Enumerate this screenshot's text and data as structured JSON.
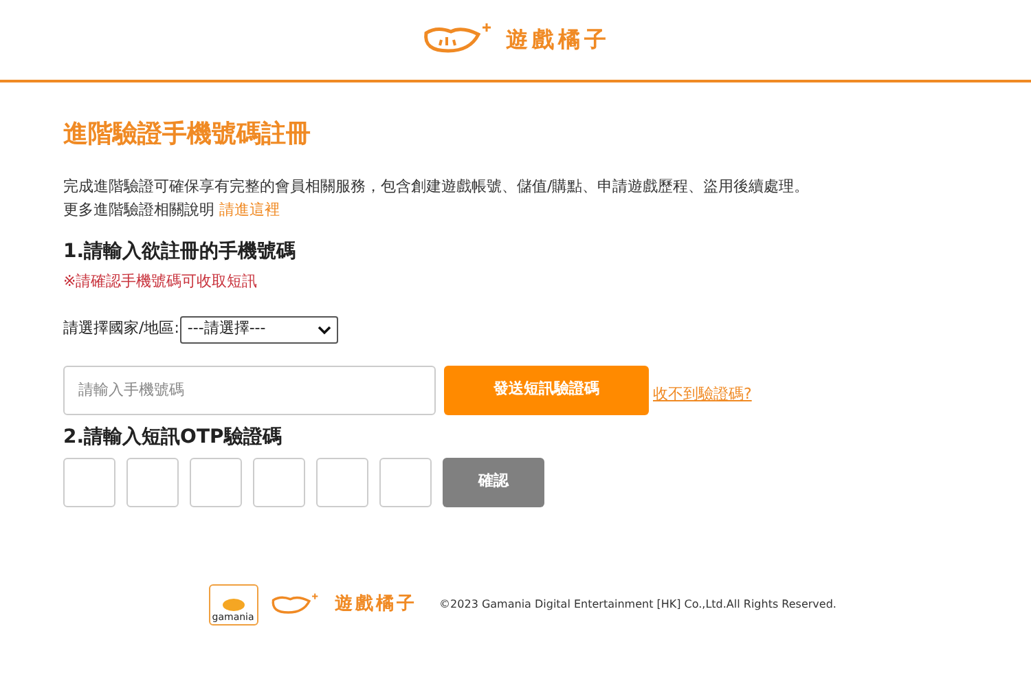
{
  "header": {
    "logo_text": "遊戲橘子"
  },
  "title": "進階驗證手機號碼註冊",
  "intro": "完成進階驗證可確保享有完整的會員相關服務，包含創建遊戲帳號、儲值/購點、申請遊戲歷程、盜用後續處理。",
  "more": {
    "text": "更多進階驗證相關說明",
    "link": "請進這裡"
  },
  "step1": {
    "heading": "1.請輸入欲註冊的手機號碼",
    "warning": "※請確認手機號碼可收取短訊",
    "region_label": "請選擇國家/地區:",
    "region_select": "---請選擇---",
    "phone_placeholder": "請輸入手機號碼",
    "send_button": "發送短訊驗證碼",
    "help_link": "收不到驗證碼?"
  },
  "step2": {
    "heading": "2.請輸入短訊OTP驗證碼",
    "confirm_button": {
      "label": "確認",
      "disabled": true
    }
  },
  "footer": {
    "badge_text": "gamania",
    "logo_text": "遊戲橘子",
    "copyright": "©2023 Gamania Digital Entertainment [HK] Co.,Ltd.All Rights Reserved."
  }
}
